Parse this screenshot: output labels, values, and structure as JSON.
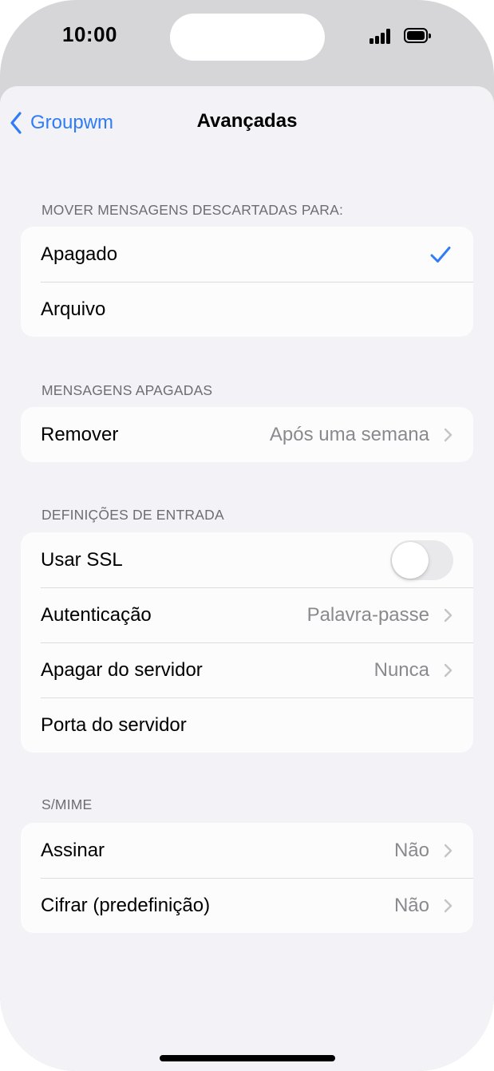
{
  "status_bar": {
    "time": "10:00"
  },
  "nav": {
    "back_label": "Groupwm",
    "title": "Avançadas"
  },
  "sections": {
    "move_discarded": {
      "header": "MOVER MENSAGENS DESCARTADAS PARA:",
      "items": [
        {
          "label": "Apagado",
          "selected": true
        },
        {
          "label": "Arquivo",
          "selected": false
        }
      ]
    },
    "deleted_messages": {
      "header": "MENSAGENS APAGADAS",
      "items": [
        {
          "label": "Remover",
          "value": "Após uma semana"
        }
      ]
    },
    "incoming_settings": {
      "header": "DEFINIÇÕES DE ENTRADA",
      "items": [
        {
          "label": "Usar SSL",
          "toggle_on": false
        },
        {
          "label": "Autenticação",
          "value": "Palavra-passe"
        },
        {
          "label": "Apagar do servidor",
          "value": "Nunca"
        },
        {
          "label": "Porta do servidor",
          "value": ""
        }
      ]
    },
    "smime": {
      "header": "S/MIME",
      "items": [
        {
          "label": "Assinar",
          "value": "Não"
        },
        {
          "label": "Cifrar (predefinição)",
          "value": "Não"
        }
      ]
    }
  },
  "colors": {
    "accent": "#2f7cf6",
    "background": "#f2f2f7",
    "secondary_text": "#8a8a8e"
  },
  "icons": {
    "back": "chevron-left-icon",
    "check": "checkmark-icon",
    "disclosure": "chevron-right-icon"
  }
}
